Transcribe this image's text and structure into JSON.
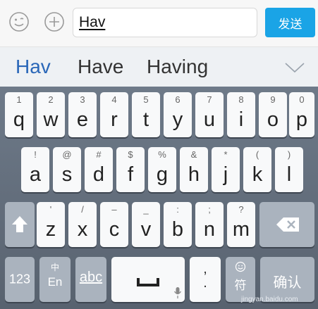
{
  "input_bar": {
    "typed_text": "Hav",
    "send_label": "发送",
    "emoji_icon": "smiley-icon",
    "add_icon": "plus-circle-icon"
  },
  "suggestions": {
    "items": [
      "Hav",
      "Have",
      "Having"
    ],
    "collapse_icon": "chevron-down-icon"
  },
  "keyboard": {
    "row1": [
      {
        "hint": "1",
        "char": "q"
      },
      {
        "hint": "2",
        "char": "w"
      },
      {
        "hint": "3",
        "char": "e"
      },
      {
        "hint": "4",
        "char": "r"
      },
      {
        "hint": "5",
        "char": "t"
      },
      {
        "hint": "6",
        "char": "y"
      },
      {
        "hint": "7",
        "char": "u"
      },
      {
        "hint": "8",
        "char": "i"
      },
      {
        "hint": "9",
        "char": "o"
      },
      {
        "hint": "0",
        "char": "p"
      }
    ],
    "row2": [
      {
        "hint": "!",
        "char": "a"
      },
      {
        "hint": "@",
        "char": "s"
      },
      {
        "hint": "#",
        "char": "d"
      },
      {
        "hint": "$",
        "char": "f"
      },
      {
        "hint": "%",
        "char": "g"
      },
      {
        "hint": "&",
        "char": "h"
      },
      {
        "hint": "*",
        "char": "j"
      },
      {
        "hint": "(",
        "char": "k"
      },
      {
        "hint": ")",
        "char": "l"
      }
    ],
    "row3": [
      {
        "hint": "'",
        "char": "z"
      },
      {
        "hint": "/",
        "char": "x"
      },
      {
        "hint": "–",
        "char": "c"
      },
      {
        "hint": "_",
        "char": "v"
      },
      {
        "hint": ":",
        "char": "b"
      },
      {
        "hint": ";",
        "char": "n"
      },
      {
        "hint": "?",
        "char": "m"
      }
    ],
    "shift_icon": "shift-arrow-icon",
    "backspace_icon": "backspace-icon",
    "numbers_label": "123",
    "lang_top": "中",
    "lang_bottom": "En",
    "abc_label": "abc",
    "space_icon": "space-bar-icon",
    "mic_icon": "microphone-icon",
    "punct_top": ",",
    "punct_bottom": ".",
    "symbol_top_icon": "smiley-icon",
    "symbol_label": "符",
    "confirm_label": "确认"
  },
  "watermark": "jingyan.baidu.com"
}
